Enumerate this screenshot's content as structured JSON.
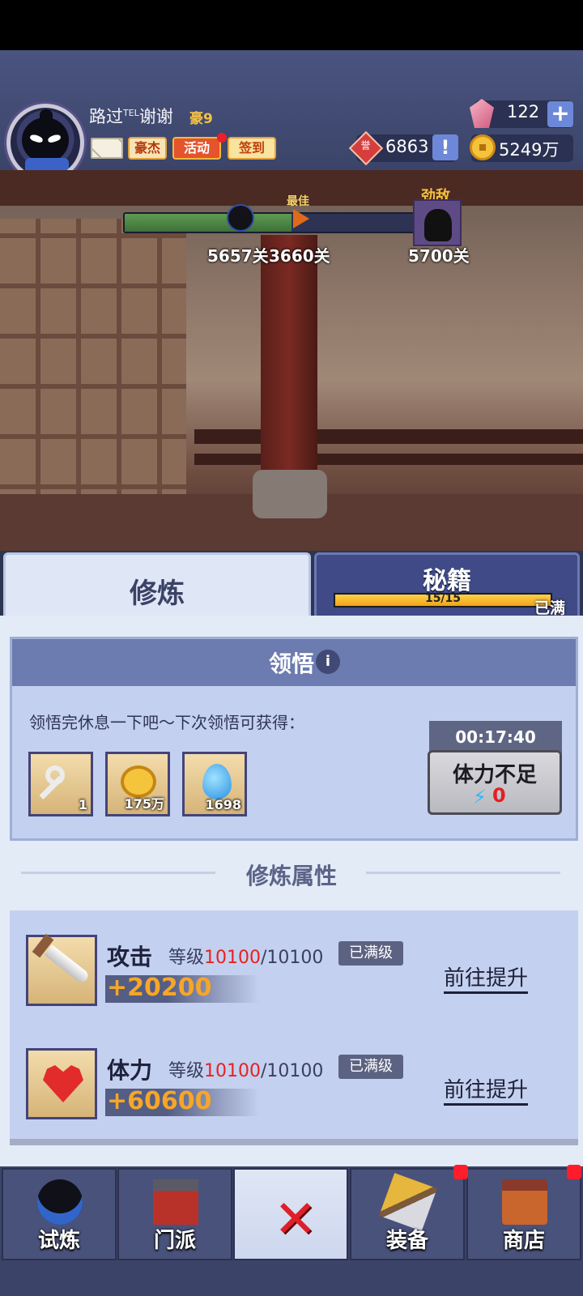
{
  "player": {
    "name": "路过",
    "name_tag": "TEL",
    "name_suffix": "谢谢",
    "vip": "豪9"
  },
  "buttons": {
    "hero": "豪杰",
    "event": "活动",
    "sign_in": "签到"
  },
  "currency": {
    "gems": "122",
    "honor_icon_text": "誉",
    "honor": "6863",
    "gold": "5249万"
  },
  "stage_progress": {
    "best_label": "最佳",
    "enemy_label": "劲敌",
    "current": "5657关",
    "best": "3660关",
    "enemy": "5700关",
    "current_value": 5657,
    "enemy_value": 5700,
    "fill_fraction": 0.58
  },
  "tabs": {
    "cultivate": "修炼",
    "secrets": "秘籍",
    "secrets_progress": "15/15",
    "secrets_status": "已满"
  },
  "enlightenment": {
    "title": "领悟",
    "info_icon": "i",
    "description": "领悟完休息一下吧～下次领悟可获得：",
    "rewards": [
      {
        "icon": "key-icon",
        "count": "1"
      },
      {
        "icon": "coin-icon",
        "count": "175万"
      },
      {
        "icon": "water-drop-icon",
        "count": "1698"
      }
    ],
    "timer": "00:17:40",
    "stamina_button": "体力不足",
    "stamina_value": "0"
  },
  "attributes": {
    "section_title": "修炼属性",
    "level_label": "等级",
    "maxed": "已满级",
    "goto": "前往提升",
    "items": [
      {
        "name": "攻击",
        "level_current": "10100",
        "level_max": "/10100",
        "bonus": "+20200",
        "icon": "sword-icon"
      },
      {
        "name": "体力",
        "level_current": "10100",
        "level_max": "/10100",
        "bonus": "+60600",
        "icon": "heart-icon"
      }
    ]
  },
  "nav": {
    "trial": "试炼",
    "sect": "门派",
    "close": "✕",
    "equipment": "装备",
    "shop": "商店"
  },
  "colors": {
    "accent_red": "#e8211e",
    "bonus_orange": "#f6a628",
    "panel_blue": "#c4d0ef"
  }
}
